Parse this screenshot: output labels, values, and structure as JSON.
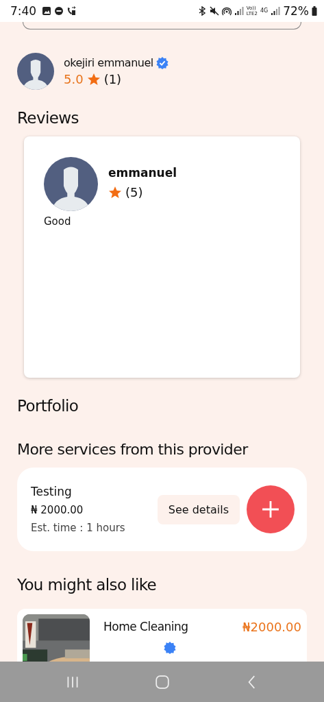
{
  "status_bar": {
    "time": "7:40",
    "volte": "Vo))",
    "lte": "LTE2",
    "network": "4G",
    "battery": "72%"
  },
  "provider": {
    "name": "okejiri emmanuel",
    "verified": true,
    "rating": "5.0",
    "count": "(1)"
  },
  "reviews": {
    "title": "Reviews",
    "items": [
      {
        "name": "emmanuel",
        "count": "(5)",
        "text": "Good"
      }
    ]
  },
  "portfolio": {
    "title": "Portfolio"
  },
  "more_services": {
    "title": "More services from this provider",
    "items": [
      {
        "name": "Testing",
        "price": "₦ 2000.00",
        "time": "Est. time : 1 hours",
        "details_button": "See details"
      }
    ]
  },
  "also_like": {
    "title": "You might also like",
    "items": [
      {
        "kind": "picture",
        "name": "Home Cleaning",
        "price": "₦2000.00",
        "verified": true
      }
    ]
  }
}
